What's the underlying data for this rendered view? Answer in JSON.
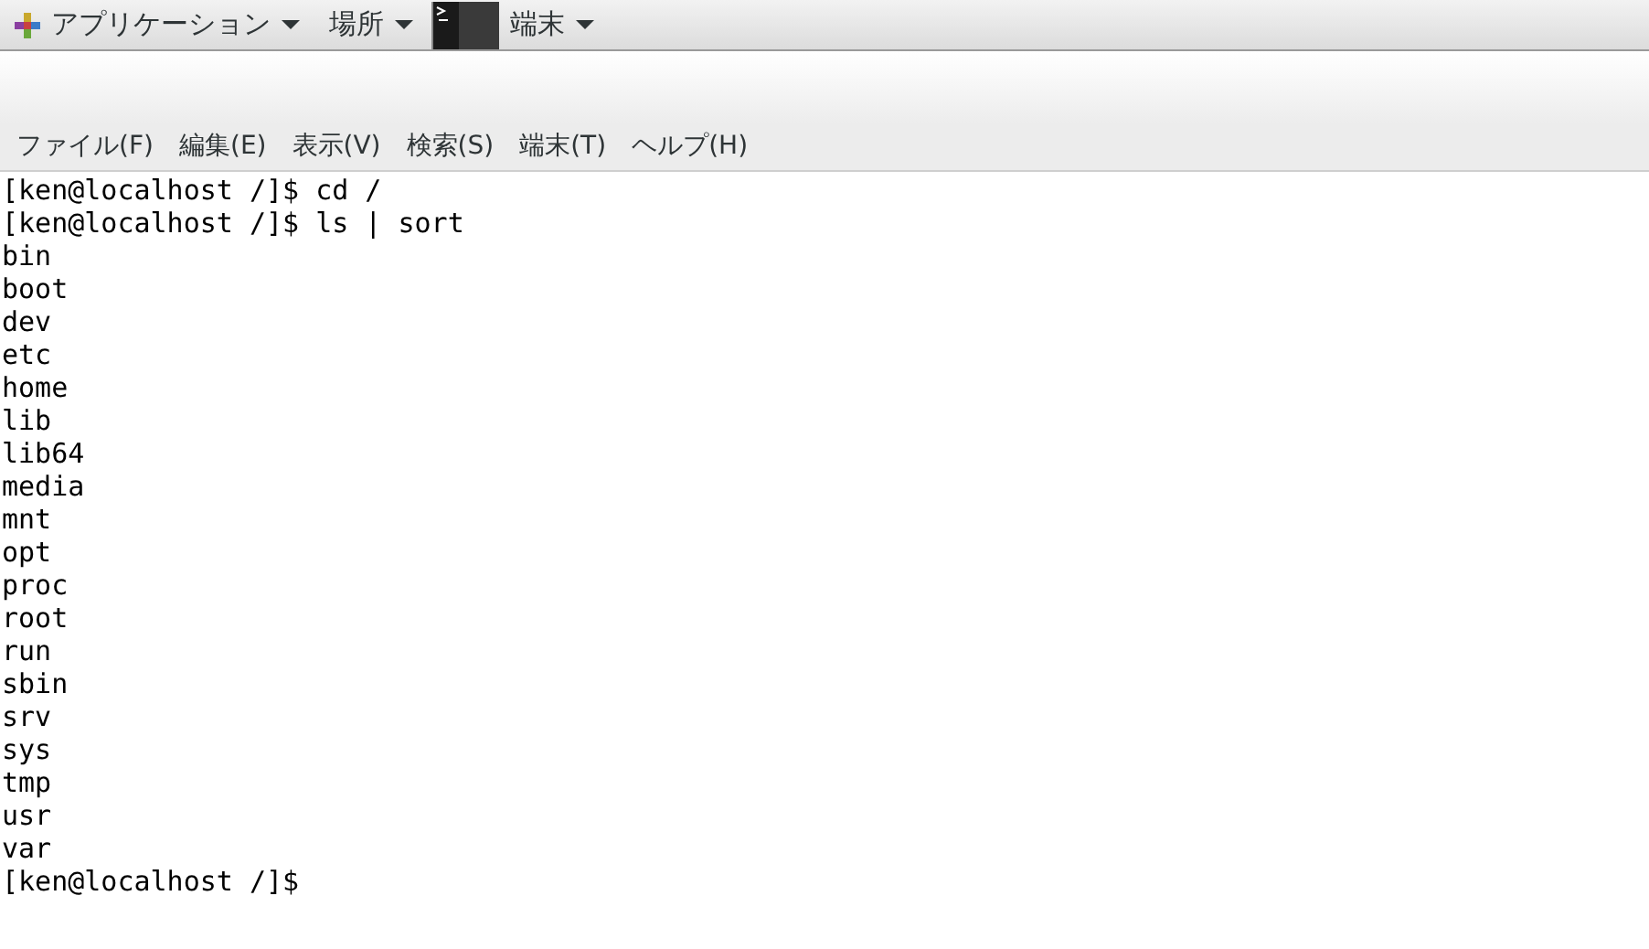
{
  "panel": {
    "menus": [
      {
        "label": "アプリケーション",
        "kind": "apps"
      },
      {
        "label": "場所",
        "kind": "plain"
      },
      {
        "label": "端末",
        "kind": "window"
      }
    ]
  },
  "menubar": [
    "ファイル(F)",
    "編集(E)",
    "表示(V)",
    "検索(S)",
    "端末(T)",
    "ヘルプ(H)"
  ],
  "terminal": {
    "lines": [
      "[ken@localhost /]$ cd /",
      "[ken@localhost /]$ ls | sort",
      "bin",
      "boot",
      "dev",
      "etc",
      "home",
      "lib",
      "lib64",
      "media",
      "mnt",
      "opt",
      "proc",
      "root",
      "run",
      "sbin",
      "srv",
      "sys",
      "tmp",
      "usr",
      "var",
      "[ken@localhost /]$"
    ]
  }
}
